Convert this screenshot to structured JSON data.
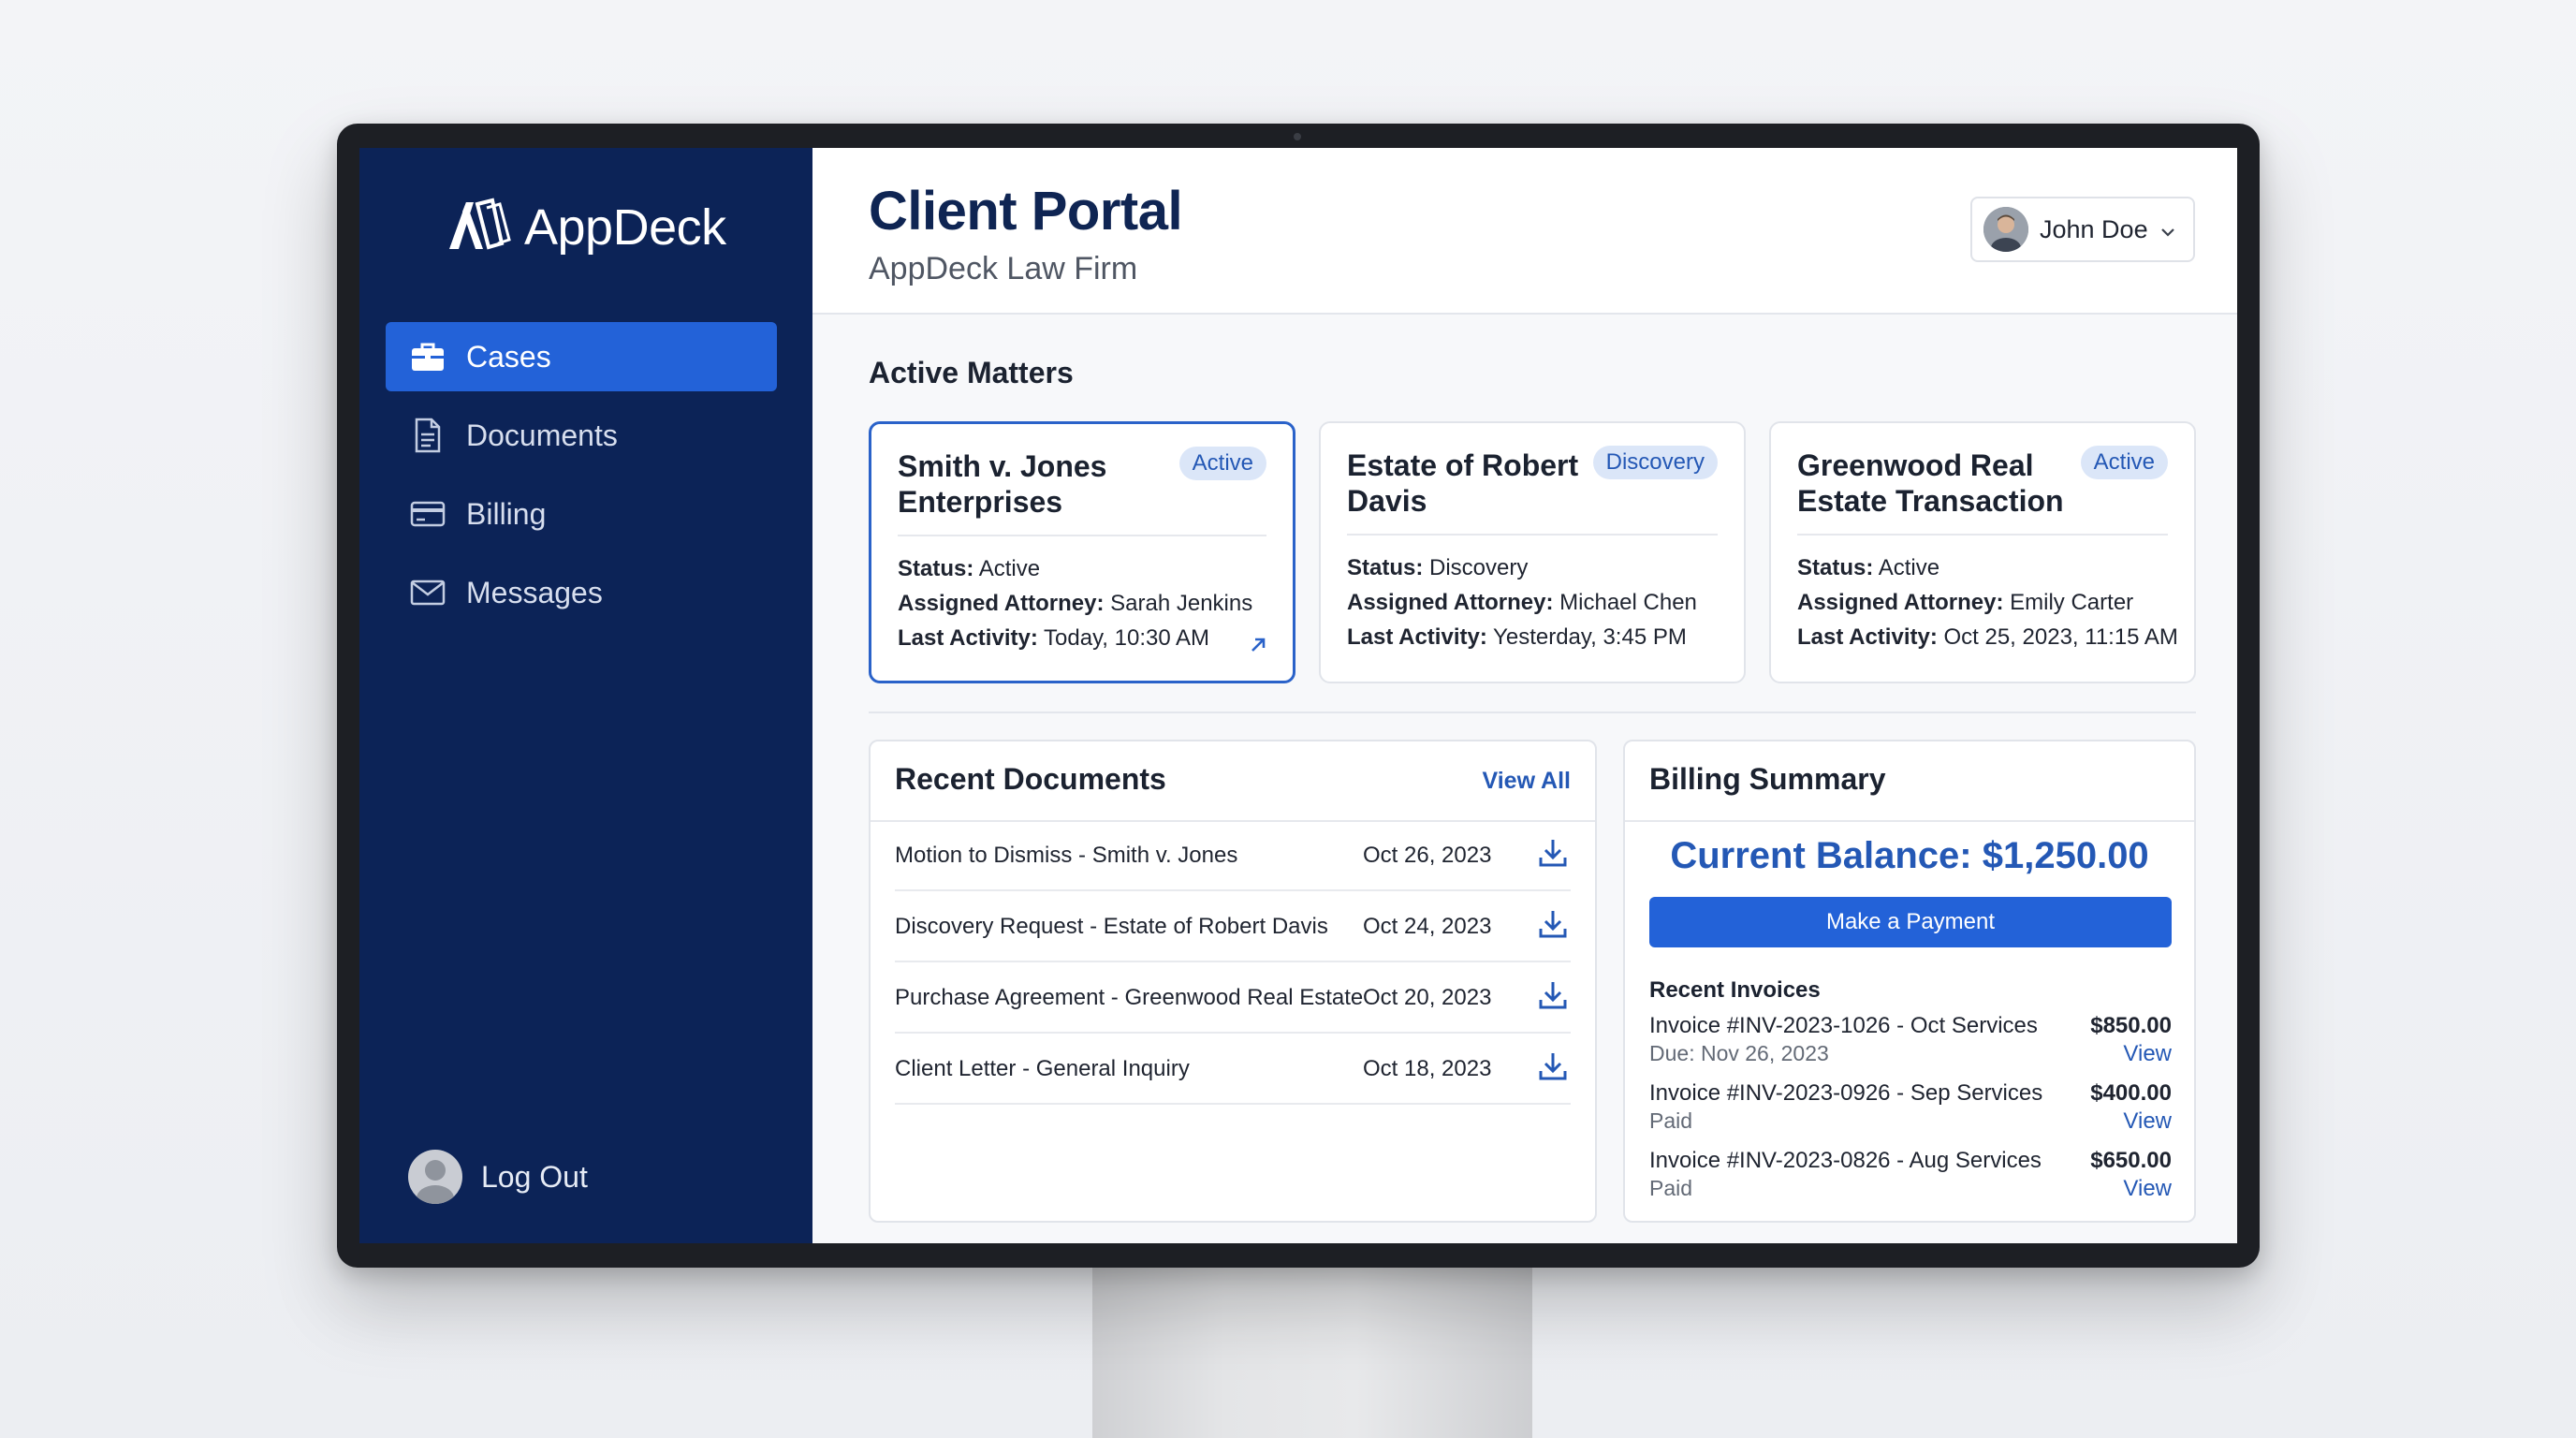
{
  "sidebar": {
    "logo_text": "AppDeck",
    "items": [
      {
        "label": "Cases",
        "icon": "briefcase-icon",
        "active": true
      },
      {
        "label": "Documents",
        "icon": "document-icon",
        "active": false
      },
      {
        "label": "Billing",
        "icon": "credit-card-icon",
        "active": false
      },
      {
        "label": "Messages",
        "icon": "mail-icon",
        "active": false
      }
    ],
    "logout_label": "Log Out"
  },
  "header": {
    "title": "Client Portal",
    "subtitle": "AppDeck Law Firm",
    "user_name": "John Doe"
  },
  "active_matters": {
    "title": "Active Matters",
    "labels": {
      "status": "Status:",
      "attorney": "Assigned Attorney:",
      "activity": "Last Activity:"
    },
    "cards": [
      {
        "title": "Smith v. Jones Enterprises",
        "badge": "Active",
        "status": "Active",
        "attorney": "Sarah Jenkins",
        "last_activity": "Today, 10:30 AM"
      },
      {
        "title": "Estate of Robert Davis",
        "badge": "Discovery",
        "status": "Discovery",
        "attorney": "Michael Chen",
        "last_activity": "Yesterday, 3:45 PM"
      },
      {
        "title": "Greenwood Real Estate Transaction",
        "badge": "Active",
        "status": "Active",
        "attorney": "Emily Carter",
        "last_activity": "Oct 25, 2023, 11:15 AM"
      }
    ]
  },
  "recent_documents": {
    "title": "Recent Documents",
    "view_all": "View All",
    "rows": [
      {
        "name": "Motion to Dismiss - Smith v. Jones",
        "date": "Oct 26, 2023"
      },
      {
        "name": "Discovery Request - Estate of Robert Davis",
        "date": "Oct 24, 2023"
      },
      {
        "name": "Purchase Agreement - Greenwood Real Estate",
        "date": "Oct 20, 2023"
      },
      {
        "name": "Client Letter - General Inquiry",
        "date": "Oct 18, 2023"
      }
    ]
  },
  "billing": {
    "title": "Billing Summary",
    "balance": "Current Balance: $1,250.00",
    "pay_button": "Make a Payment",
    "invoices_title": "Recent Invoices",
    "invoices": [
      {
        "title": "Invoice #INV-2023-1026 - Oct Services",
        "sub": "Due: Nov 26, 2023",
        "amount": "$850.00",
        "view": "View"
      },
      {
        "title": "Invoice #INV-2023-0926 - Sep Services",
        "sub": "Paid",
        "amount": "$400.00",
        "view": "View"
      },
      {
        "title": "Invoice #INV-2023-0826 - Aug Services",
        "sub": "Paid",
        "amount": "$650.00",
        "view": "View"
      }
    ]
  },
  "colors": {
    "sidebar_bg": "#0c2357",
    "accent": "#2362d8",
    "title": "#0f2553",
    "badge_bg": "#dbe6f8"
  }
}
